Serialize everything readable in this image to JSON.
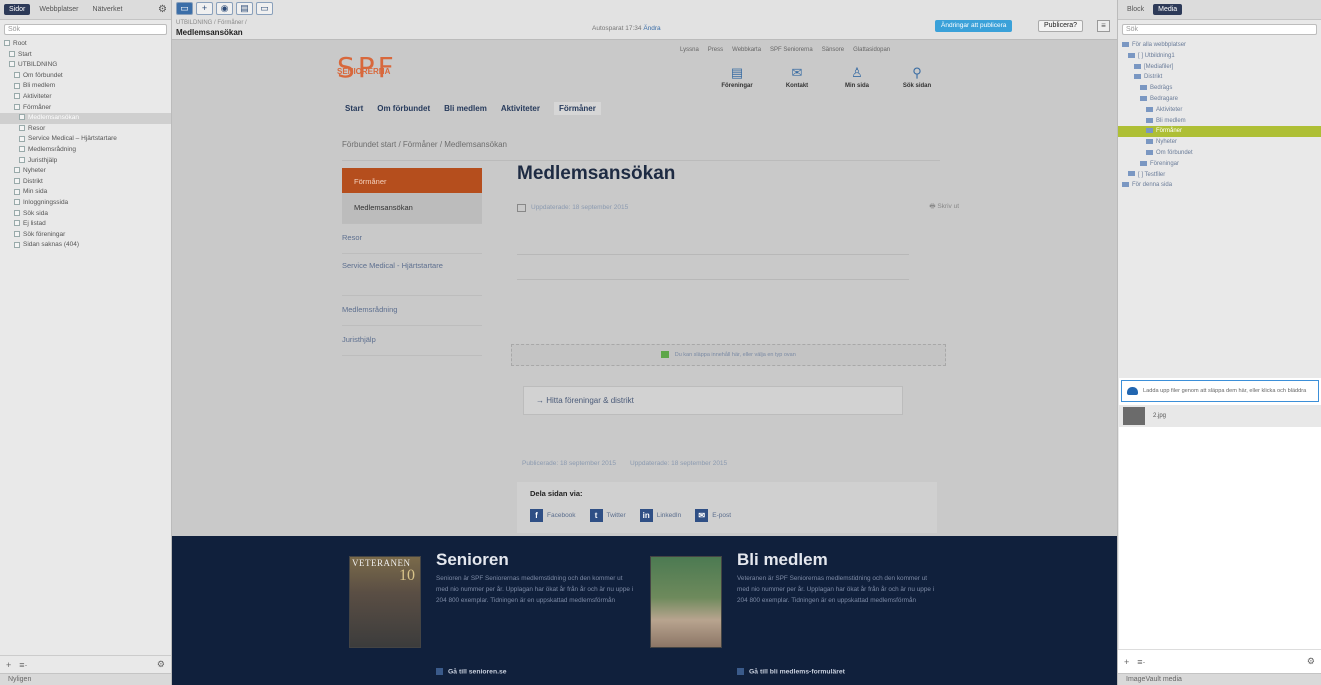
{
  "left_sidebar": {
    "tabs": [
      "Sidor",
      "Webbplatser",
      "Nätverket"
    ],
    "search_placeholder": "Sök",
    "tree": [
      {
        "label": "Root",
        "selected": false
      },
      {
        "label": "Start",
        "selected": false
      },
      {
        "label": "UTBILDNING",
        "selected": false
      },
      {
        "label": "Om förbundet",
        "selected": false
      },
      {
        "label": "Bli medlem",
        "selected": false
      },
      {
        "label": "Aktiviteter",
        "selected": false
      },
      {
        "label": "Förmåner",
        "selected": false
      },
      {
        "label": "Medlemsansökan",
        "selected": true
      },
      {
        "label": "Resor",
        "selected": false
      },
      {
        "label": "Service Medical – Hjärtstartare",
        "selected": false
      },
      {
        "label": "Medlemsrådning",
        "selected": false
      },
      {
        "label": "Juristhjälp",
        "selected": false
      },
      {
        "label": "Nyheter",
        "selected": false
      },
      {
        "label": "Distrikt",
        "selected": false
      },
      {
        "label": "Min sida",
        "selected": false
      },
      {
        "label": "Inloggningssida",
        "selected": false
      },
      {
        "label": "Sök sida",
        "selected": false
      },
      {
        "label": "Ej listad",
        "selected": false
      },
      {
        "label": "Sök föreningar",
        "selected": false
      },
      {
        "label": "Sidan saknas (404)",
        "selected": false
      }
    ],
    "footer_add": "+",
    "footer_menu": "≡·",
    "footer_gear": "⚙",
    "status": "Nyligen"
  },
  "toolbar": {
    "buttons": [
      "▭",
      "+",
      "◉",
      "▤",
      "▭"
    ],
    "breadcrumb": "UTBILDNING / Förmåner /",
    "title": "Medlemsansökan",
    "autosave_text": "Autosparat 17:34",
    "autosave_link": "Ändra",
    "publish_info": "Ändringar att publicera",
    "publish_button": "Publicera?",
    "list_icon": "≡"
  },
  "site": {
    "utility_links": [
      "Lyssna",
      "Press",
      "Webbkarta",
      "SPF Seniorerna",
      "Sänsore",
      "Glattasidopan"
    ],
    "logo_text": "SPF",
    "logo_sub": "SENIORERNA",
    "quick_links": [
      {
        "icon": "▤",
        "label": "Föreningar"
      },
      {
        "icon": "✉",
        "label": "Kontakt"
      },
      {
        "icon": "♙",
        "label": "Min sida"
      },
      {
        "icon": "⚲",
        "label": "Sök sidan"
      }
    ],
    "nav": [
      "Start",
      "Om förbundet",
      "Bli medlem",
      "Aktiviteter",
      "Förmåner"
    ],
    "nav_active": "Förmåner",
    "breadcrumb": "Förbundet start  /  Förmåner  /  Medlemsansökan",
    "side_menu": [
      {
        "label": "Förmåner",
        "type": "active-red"
      },
      {
        "label": "Medlemsansökan",
        "type": "current"
      },
      {
        "label": "Resor",
        "type": "normal"
      },
      {
        "label": "Service Medical - Hjärtstartare",
        "type": "two-line"
      },
      {
        "label": "Medlemsrådning",
        "type": "normal"
      },
      {
        "label": "Juristhjälp",
        "type": "normal"
      }
    ],
    "page_title": "Medlemsansökan",
    "updated": "Uppdaterade: 18 september 2015",
    "print": "Skriv ut",
    "dropzone_text": "Du kan släppa innehåll här, eller välja en typ ovan",
    "find_link": "→  Hitta föreningar & distrikt",
    "published": "Publicerade: 18 september 2015",
    "updated2": "Uppdaterade: 18 september 2015",
    "share_title": "Dela sidan via:",
    "share_links": [
      {
        "icon": "f",
        "label": "Facebook"
      },
      {
        "icon": "t",
        "label": "Twitter"
      },
      {
        "icon": "in",
        "label": "LinkedIn"
      },
      {
        "icon": "✉",
        "label": "E-post"
      }
    ],
    "footer": [
      {
        "image_label": "VETERANEN",
        "image_number": "10",
        "title": "Senioren",
        "body": "Senioren är SPF Seniorernas medlemstidning och den kommer ut med nio nummer per år. Upplagan har ökat år från år och är nu uppe i 204 800 exemplar. Tidningen är en uppskattad medlemsförmån",
        "link": "Gå till senioren.se"
      },
      {
        "image_label": "",
        "image_number": "",
        "title": "Bli medlem",
        "body": "Veteranen är SPF Seniorernas medlemstidning och den kommer ut med nio nummer per år. Upplagan har ökat år från år och är nu uppe i 204 800 exemplar. Tidningen är en uppskattad medlemsförmån",
        "link": "Gå till bli medlems-formuläret"
      }
    ]
  },
  "right_sidebar": {
    "tabs": [
      "Block",
      "Media"
    ],
    "search_placeholder": "Sök",
    "tree": [
      {
        "label": "För alla webbplatser",
        "highlight": false
      },
      {
        "label": "[ ] Utbildning1",
        "highlight": false
      },
      {
        "label": "[Mediafiler]",
        "highlight": false
      },
      {
        "label": "Distrikt",
        "highlight": false
      },
      {
        "label": "Bedrägs",
        "highlight": false
      },
      {
        "label": "Bedragare",
        "highlight": false
      },
      {
        "label": "Aktiviteter",
        "highlight": false
      },
      {
        "label": "Bli medlem",
        "highlight": false
      },
      {
        "label": "Förmåner",
        "highlight": true
      },
      {
        "label": "Nyheter",
        "highlight": false
      },
      {
        "label": "Om förbundet",
        "highlight": false
      },
      {
        "label": "Föreningar",
        "highlight": false
      },
      {
        "label": "[ ] Testfiler",
        "highlight": false
      },
      {
        "label": "För denna sida",
        "highlight": false
      }
    ],
    "upload_text": "Ladda upp filer genom att släppa dem här, eller klicka och bläddra",
    "file_name": "2.jpg",
    "footer_add": "+",
    "footer_menu": "≡·",
    "footer_gear": "⚙",
    "status": "ImageVault media"
  }
}
